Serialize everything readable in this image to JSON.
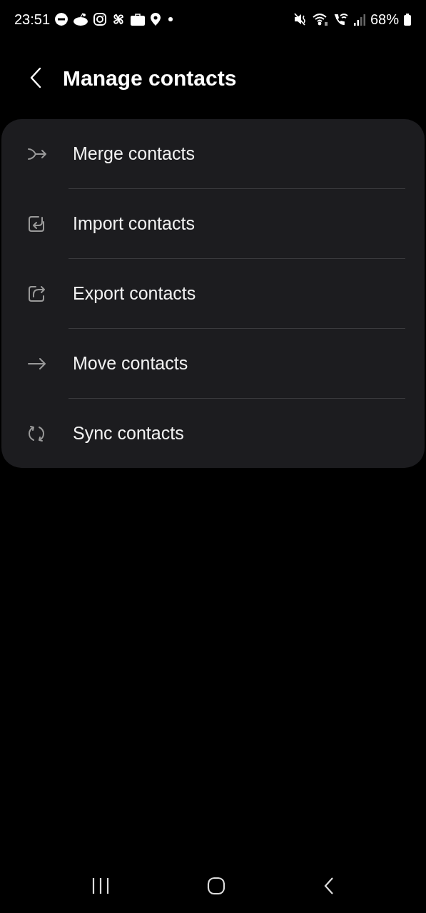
{
  "status_bar": {
    "time": "23:51",
    "battery": "68%"
  },
  "header": {
    "title": "Manage contacts"
  },
  "items": [
    {
      "label": "Merge contacts",
      "kind": "merge"
    },
    {
      "label": "Import contacts",
      "kind": "import"
    },
    {
      "label": "Export contacts",
      "kind": "export"
    },
    {
      "label": "Move contacts",
      "kind": "move"
    },
    {
      "label": "Sync contacts",
      "kind": "sync"
    }
  ]
}
